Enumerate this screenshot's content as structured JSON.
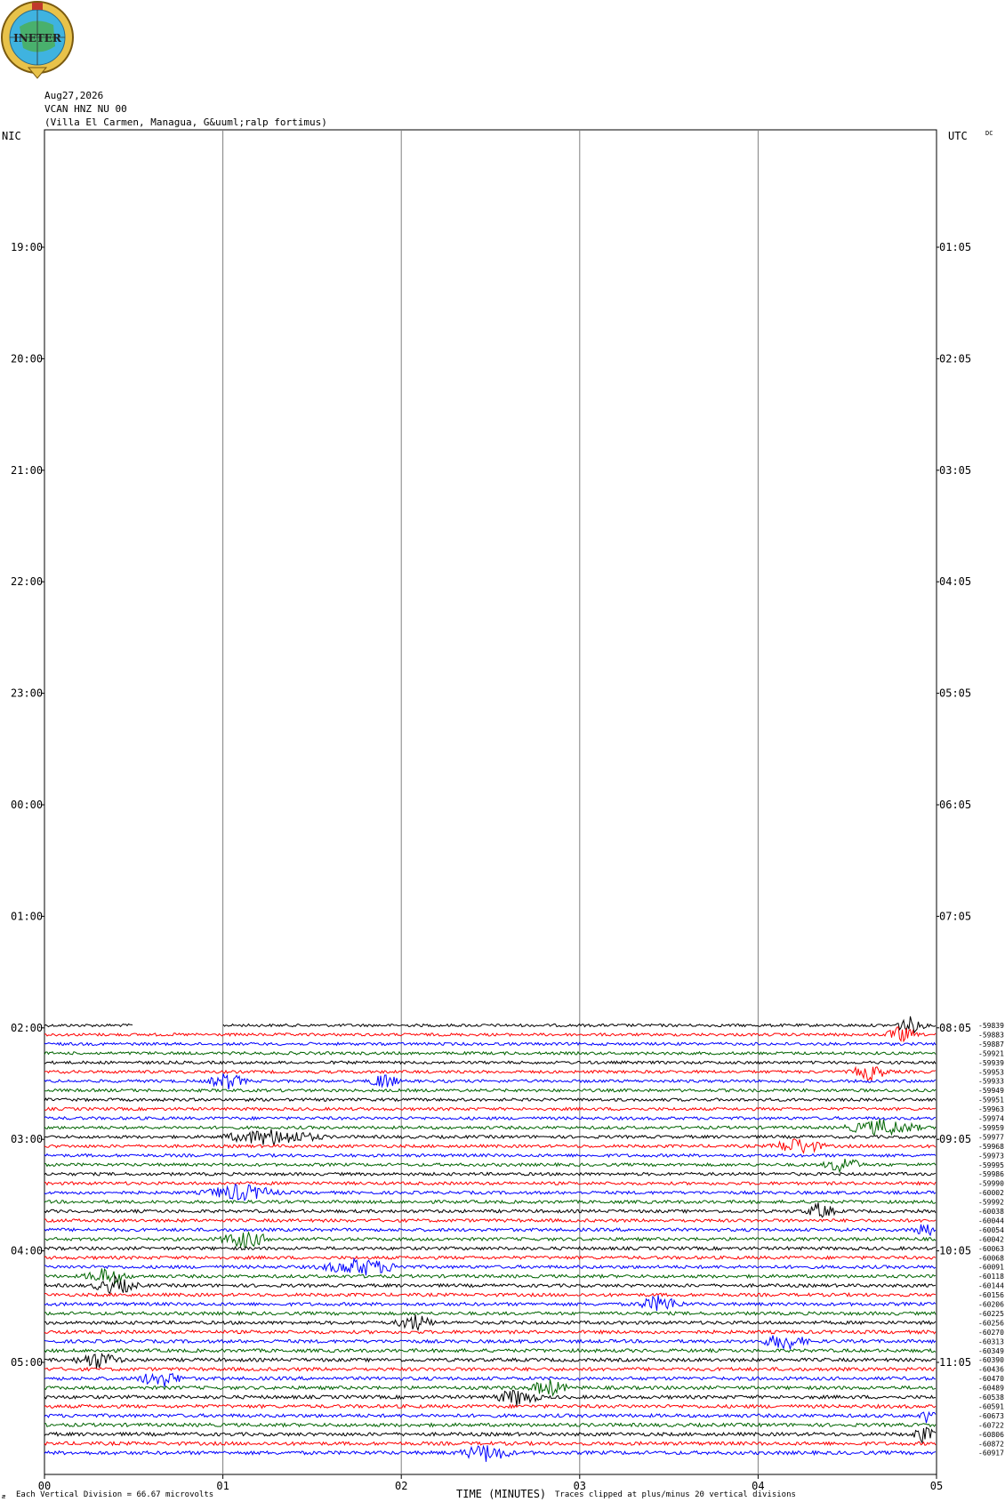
{
  "logo": {
    "text": "INETER"
  },
  "header": {
    "date": "Aug27,2026",
    "station": "VCAN HNZ NU 00",
    "location": "(Villa El Carmen, Managua, G&uuml;ralp fortimus)"
  },
  "corners": {
    "left": "NIC",
    "right": "UTC",
    "dc": "DC"
  },
  "footer": {
    "glyph": "æ",
    "scale": "Each Vertical Division =   66.67 microvolts",
    "xlabel": "TIME (MINUTES)",
    "clip": "Traces clipped at plus/minus 20 vertical divisions"
  },
  "colors": {
    "black": "#000000",
    "red": "#ff0000",
    "blue": "#0000ff",
    "green": "#006400",
    "grid": "#808080"
  },
  "chart_data": {
    "type": "line",
    "xlabel": "TIME (MINUTES)",
    "x_ticks": [
      "00",
      "01",
      "02",
      "03",
      "04",
      "05"
    ],
    "xlim": [
      0,
      5
    ],
    "left_time_labels": [
      "19:00",
      "20:00",
      "21:00",
      "22:00",
      "23:00",
      "00:00",
      "01:00",
      "02:00",
      "03:00",
      "04:00",
      "05:00"
    ],
    "right_time_labels": [
      "01:05",
      "02:05",
      "03:05",
      "04:05",
      "05:05",
      "06:05",
      "07:05",
      "08:05",
      "09:05",
      "10:05",
      "11:05"
    ],
    "trace_color_cycle": [
      "black",
      "red",
      "blue",
      "green"
    ],
    "dc_offsets": [
      -59839,
      -59883,
      -59887,
      -59921,
      -59939,
      -59953,
      -59933,
      -59949,
      -59951,
      -59963,
      -59974,
      -59959,
      -59977,
      -59968,
      -59973,
      -59995,
      -59986,
      -59990,
      -60002,
      -59992,
      -60038,
      -60044,
      -60054,
      -60042,
      -60063,
      -60068,
      -60091,
      -60118,
      -60144,
      -60156,
      -60206,
      -60225,
      -60256,
      -60270,
      -60313,
      -60349,
      -60390,
      -60436,
      -60470,
      -60489,
      -60538,
      -60591,
      -60673,
      -60722,
      -60806,
      -60872,
      -60917
    ],
    "events": [
      {
        "trace": 0,
        "start_min": 4.75,
        "end_min": 4.95
      },
      {
        "trace": 1,
        "start_min": 4.7,
        "end_min": 4.9
      },
      {
        "trace": 5,
        "start_min": 4.5,
        "end_min": 4.75
      },
      {
        "trace": 6,
        "start_min": 0.9,
        "end_min": 1.15
      },
      {
        "trace": 6,
        "start_min": 1.8,
        "end_min": 2.0
      },
      {
        "trace": 11,
        "start_min": 4.45,
        "end_min": 4.95
      },
      {
        "trace": 12,
        "start_min": 0.95,
        "end_min": 1.6
      },
      {
        "trace": 13,
        "start_min": 4.05,
        "end_min": 4.4
      },
      {
        "trace": 15,
        "start_min": 4.35,
        "end_min": 4.6
      },
      {
        "trace": 18,
        "start_min": 0.85,
        "end_min": 1.35
      },
      {
        "trace": 20,
        "start_min": 4.25,
        "end_min": 4.45
      },
      {
        "trace": 22,
        "start_min": 4.85,
        "end_min": 5.0
      },
      {
        "trace": 23,
        "start_min": 0.95,
        "end_min": 1.3
      },
      {
        "trace": 26,
        "start_min": 1.5,
        "end_min": 2.05
      },
      {
        "trace": 27,
        "start_min": 0.2,
        "end_min": 0.5
      },
      {
        "trace": 28,
        "start_min": 0.25,
        "end_min": 0.55
      },
      {
        "trace": 30,
        "start_min": 3.3,
        "end_min": 3.6
      },
      {
        "trace": 32,
        "start_min": 1.95,
        "end_min": 2.2
      },
      {
        "trace": 34,
        "start_min": 4.0,
        "end_min": 4.3
      },
      {
        "trace": 36,
        "start_min": 0.15,
        "end_min": 0.45
      },
      {
        "trace": 38,
        "start_min": 0.5,
        "end_min": 0.8
      },
      {
        "trace": 39,
        "start_min": 2.7,
        "end_min": 2.95
      },
      {
        "trace": 40,
        "start_min": 2.5,
        "end_min": 2.8
      },
      {
        "trace": 42,
        "start_min": 4.9,
        "end_min": 5.0
      },
      {
        "trace": 44,
        "start_min": 4.85,
        "end_min": 5.0
      },
      {
        "trace": 46,
        "start_min": 2.3,
        "end_min": 2.65
      }
    ]
  }
}
